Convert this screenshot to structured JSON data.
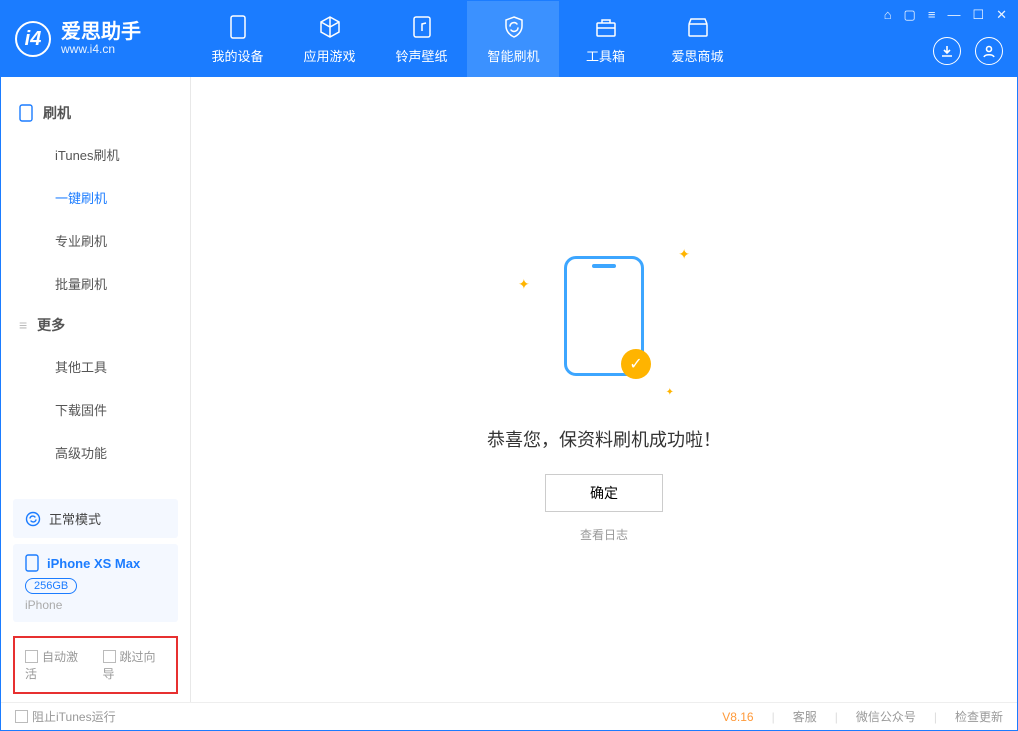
{
  "logo": {
    "name": "爱思助手",
    "url": "www.i4.cn"
  },
  "nav": [
    {
      "label": "我的设备"
    },
    {
      "label": "应用游戏"
    },
    {
      "label": "铃声壁纸"
    },
    {
      "label": "智能刷机"
    },
    {
      "label": "工具箱"
    },
    {
      "label": "爱思商城"
    }
  ],
  "sidebar": {
    "group1_title": "刷机",
    "group1_items": [
      "iTunes刷机",
      "一键刷机",
      "专业刷机",
      "批量刷机"
    ],
    "group2_title": "更多",
    "group2_items": [
      "其他工具",
      "下载固件",
      "高级功能"
    ]
  },
  "mode": {
    "label": "正常模式"
  },
  "device": {
    "name": "iPhone XS Max",
    "capacity": "256GB",
    "type": "iPhone"
  },
  "options": {
    "auto_activate": "自动激活",
    "skip_guide": "跳过向导"
  },
  "main": {
    "message": "恭喜您，保资料刷机成功啦！",
    "ok": "确定",
    "view_log": "查看日志"
  },
  "footer": {
    "block_itunes": "阻止iTunes运行",
    "version": "V8.16",
    "support": "客服",
    "wechat": "微信公众号",
    "update": "检查更新"
  }
}
